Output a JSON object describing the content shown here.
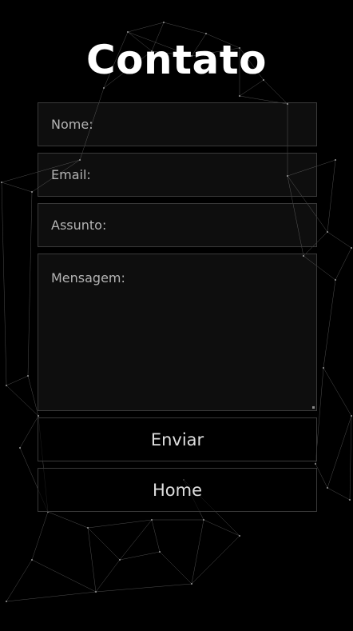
{
  "page": {
    "title": "Contato",
    "background_color": "#000000",
    "network_line_color": "#8f8f8f"
  },
  "form": {
    "name_placeholder": "Nome:",
    "email_placeholder": "Email:",
    "subject_placeholder": "Assunto:",
    "message_placeholder": "Mensagem:",
    "submit_label": "Enviar",
    "home_label": "Home"
  }
}
